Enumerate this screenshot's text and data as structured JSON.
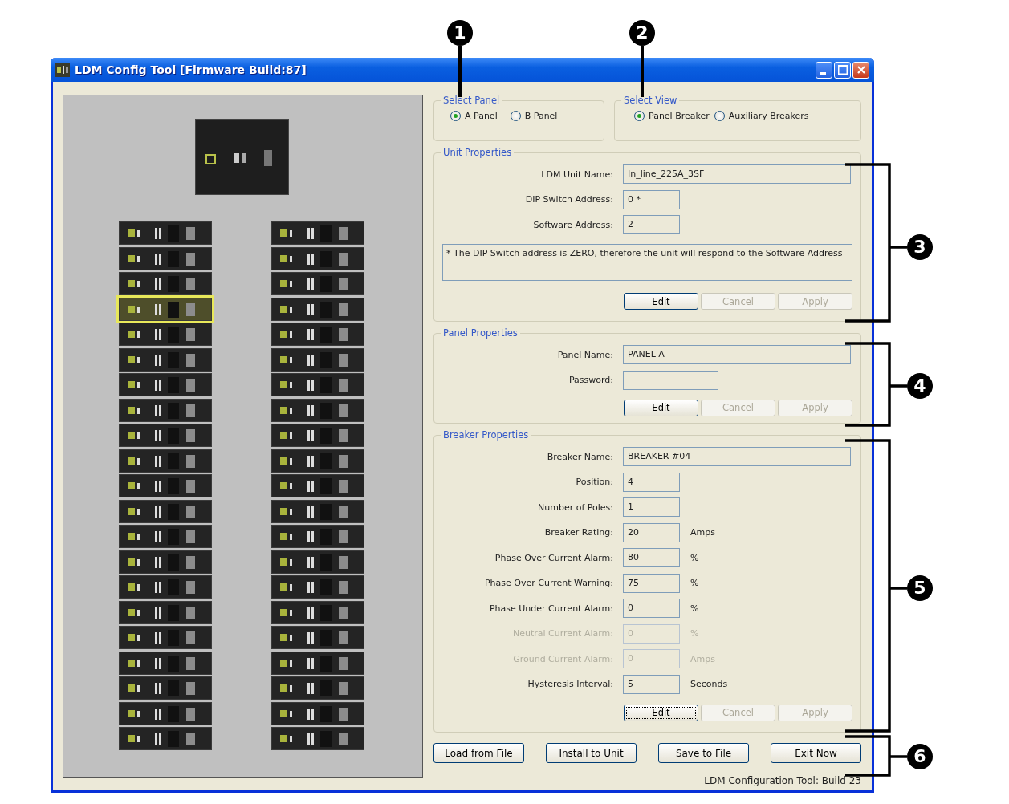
{
  "window": {
    "title": "LDM Config Tool [Firmware Build:87]"
  },
  "callouts": [
    {
      "number": "1"
    },
    {
      "number": "2"
    },
    {
      "number": "3"
    },
    {
      "number": "4"
    },
    {
      "number": "5"
    },
    {
      "number": "6"
    }
  ],
  "panel_view": {
    "columns": [
      {
        "breakers": [
          {
            "selected": false
          },
          {
            "selected": false
          },
          {
            "selected": false
          },
          {
            "selected": true
          },
          {
            "selected": false
          },
          {
            "selected": false
          },
          {
            "selected": false
          },
          {
            "selected": false
          },
          {
            "selected": false
          },
          {
            "selected": false
          },
          {
            "selected": false
          },
          {
            "selected": false
          },
          {
            "selected": false
          },
          {
            "selected": false
          },
          {
            "selected": false
          },
          {
            "selected": false
          },
          {
            "selected": false
          },
          {
            "selected": false
          },
          {
            "selected": false
          },
          {
            "selected": false
          },
          {
            "selected": false
          }
        ]
      },
      {
        "breakers": [
          {
            "selected": false
          },
          {
            "selected": false
          },
          {
            "selected": false
          },
          {
            "selected": false
          },
          {
            "selected": false
          },
          {
            "selected": false
          },
          {
            "selected": false
          },
          {
            "selected": false
          },
          {
            "selected": false
          },
          {
            "selected": false
          },
          {
            "selected": false
          },
          {
            "selected": false
          },
          {
            "selected": false
          },
          {
            "selected": false
          },
          {
            "selected": false
          },
          {
            "selected": false
          },
          {
            "selected": false
          },
          {
            "selected": false
          },
          {
            "selected": false
          },
          {
            "selected": false
          },
          {
            "selected": false
          }
        ]
      }
    ]
  },
  "select_panel": {
    "legend": "Select Panel",
    "options": [
      {
        "label": "A Panel",
        "selected": true
      },
      {
        "label": "B Panel",
        "selected": false
      }
    ]
  },
  "select_view": {
    "legend": "Select View",
    "options": [
      {
        "label": "Panel Breaker",
        "selected": true
      },
      {
        "label": "Auxiliary Breakers",
        "selected": false
      }
    ]
  },
  "unit_properties": {
    "legend": "Unit Properties",
    "fields": [
      {
        "label": "LDM Unit Name:",
        "value": "In_line_225A_3SF",
        "kind": "wide",
        "disabled": false
      },
      {
        "label": "DIP Switch Address:",
        "value": "0 *",
        "kind": "short",
        "disabled": false
      },
      {
        "label": "Software Address:",
        "value": "2",
        "kind": "short",
        "disabled": false
      }
    ],
    "note": "* The DIP Switch address is ZERO, therefore the unit will respond to the Software Address",
    "buttons": [
      {
        "label": "Edit",
        "disabled": false,
        "focused": false
      },
      {
        "label": "Cancel",
        "disabled": true,
        "focused": false
      },
      {
        "label": "Apply",
        "disabled": true,
        "focused": false
      }
    ]
  },
  "panel_properties": {
    "legend": "Panel Properties",
    "fields": [
      {
        "label": "Panel Name:",
        "value": "PANEL A",
        "kind": "wide",
        "disabled": false
      },
      {
        "label": "Password:",
        "kind": "medium",
        "disabled": false
      }
    ],
    "buttons": [
      {
        "label": "Edit",
        "disabled": false,
        "focused": false
      },
      {
        "label": "Cancel",
        "disabled": true,
        "focused": false
      },
      {
        "label": "Apply",
        "disabled": true,
        "focused": false
      }
    ]
  },
  "breaker_properties": {
    "legend": "Breaker Properties",
    "fields": [
      {
        "label": "Breaker Name:",
        "value": "BREAKER #04",
        "kind": "wide",
        "disabled": false
      },
      {
        "label": "Position:",
        "value": "4",
        "kind": "short",
        "disabled": false
      },
      {
        "label": "Number of Poles:",
        "value": "1",
        "kind": "short",
        "disabled": false
      },
      {
        "label": "Breaker Rating:",
        "value": "20",
        "kind": "short",
        "disabled": false,
        "unit": "Amps"
      },
      {
        "label": "Phase Over Current Alarm:",
        "value": "80",
        "kind": "short",
        "disabled": false,
        "unit": "%"
      },
      {
        "label": "Phase Over Current Warning:",
        "value": "75",
        "kind": "short",
        "disabled": false,
        "unit": "%"
      },
      {
        "label": "Phase Under Current Alarm:",
        "value": "0",
        "kind": "short",
        "disabled": false,
        "unit": "%"
      },
      {
        "label": "Neutral Current Alarm:",
        "value": "0",
        "kind": "short",
        "disabled": true,
        "unit": "%"
      },
      {
        "label": "Ground Current Alarm:",
        "value": "0",
        "kind": "short",
        "disabled": true,
        "unit": "Amps"
      },
      {
        "label": "Hysteresis Interval:",
        "value": "5",
        "kind": "short",
        "disabled": false,
        "unit": "Seconds"
      }
    ],
    "buttons": [
      {
        "label": "Edit",
        "disabled": false,
        "focused": true
      },
      {
        "label": "Cancel",
        "disabled": true,
        "focused": false
      },
      {
        "label": "Apply",
        "disabled": true,
        "focused": false
      }
    ]
  },
  "actions": [
    {
      "label": "Load from File"
    },
    {
      "label": "Install to Unit"
    },
    {
      "label": "Save to File"
    },
    {
      "label": "Exit Now"
    }
  ],
  "status": "LDM Configuration Tool: Build 23"
}
